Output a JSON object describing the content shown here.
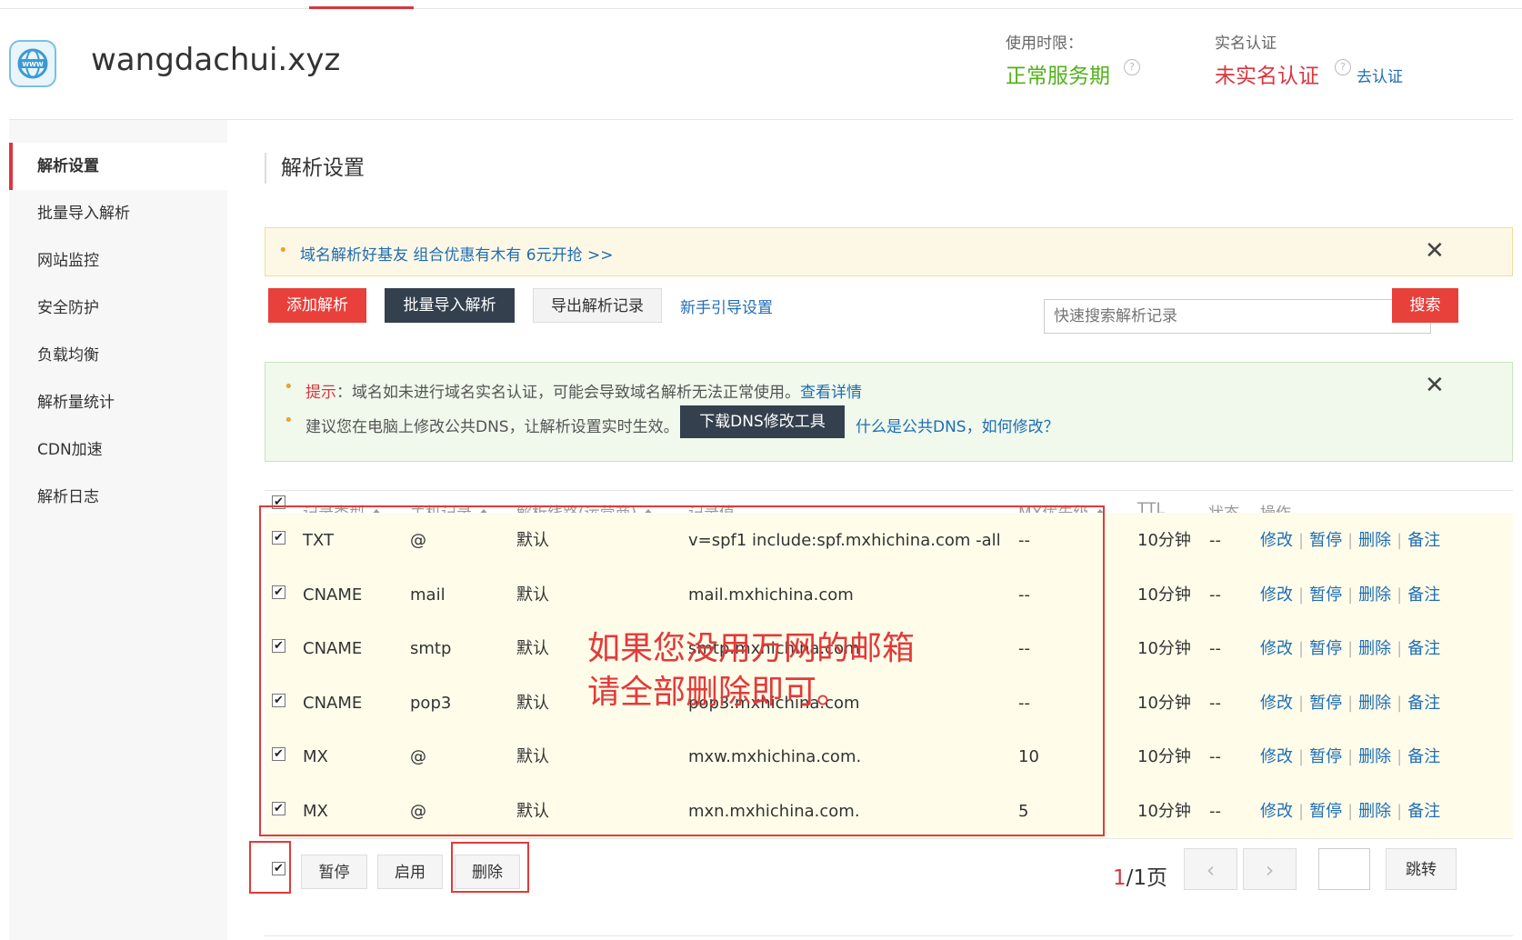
{
  "header": {
    "domain": "wangdachui.xyz",
    "usage_label": "使用时限：",
    "usage_value": "正常服务期",
    "realname_label": "实名认证",
    "realname_value": "未实名认证",
    "realname_link": "去认证",
    "help_glyph": "?",
    "colors": {
      "usage": "#52b21a",
      "realname": "#d9363e",
      "link": "#1f6db5"
    }
  },
  "sidebar": {
    "items": [
      {
        "label": "解析设置",
        "active": true
      },
      {
        "label": "批量导入解析"
      },
      {
        "label": "网站监控"
      },
      {
        "label": "安全防护"
      },
      {
        "label": "负载均衡"
      },
      {
        "label": "解析量统计"
      },
      {
        "label": "CDN加速"
      },
      {
        "label": "解析日志"
      }
    ]
  },
  "main": {
    "title": "解析设置",
    "promo": {
      "text": "域名解析好基友 组合优惠有木有 6元开抢 >>",
      "close": "✕"
    },
    "toolbar": {
      "add": "添加解析",
      "batch_import": "批量导入解析",
      "export": "导出解析记录",
      "guide": "新手引导设置",
      "search_placeholder": "快速搜索解析记录",
      "search": "搜索"
    },
    "notice": {
      "tip_label": "提示",
      "tip_text": "：域名如未进行域名实名认证，可能会导致域名解析无法正常使用。",
      "tip_link": "查看详情",
      "dns_text": "建议您在电脑上修改公共DNS，让解析设置实时生效。",
      "dns_button": "下载DNS修改工具",
      "dns_link": "什么是公共DNS，如何修改？",
      "close": "✕"
    }
  },
  "table": {
    "headers": [
      "记录类型",
      "主机记录",
      "解析线路(运营商)",
      "记录值",
      "MX优先级",
      "TTL",
      "状态",
      "操作"
    ],
    "rows": [
      {
        "type": "TXT",
        "host": "@",
        "line": "默认",
        "value": "v=spf1 include:spf.mxhichina.com -all",
        "mx": "--",
        "ttl": "10分钟",
        "status": "--"
      },
      {
        "type": "CNAME",
        "host": "mail",
        "line": "默认",
        "value": "mail.mxhichina.com",
        "mx": "--",
        "ttl": "10分钟",
        "status": "--"
      },
      {
        "type": "CNAME",
        "host": "smtp",
        "line": "默认",
        "value": "smtp.mxhichina.com",
        "mx": "--",
        "ttl": "10分钟",
        "status": "--"
      },
      {
        "type": "CNAME",
        "host": "pop3",
        "line": "默认",
        "value": "pop3.mxhichina.com",
        "mx": "--",
        "ttl": "10分钟",
        "status": "--"
      },
      {
        "type": "MX",
        "host": "@",
        "line": "默认",
        "value": "mxw.mxhichina.com.",
        "mx": "10",
        "ttl": "10分钟",
        "status": "--"
      },
      {
        "type": "MX",
        "host": "@",
        "line": "默认",
        "value": "mxn.mxhichina.com.",
        "mx": "5",
        "ttl": "10分钟",
        "status": "--"
      }
    ],
    "actions": [
      "修改",
      "暂停",
      "删除",
      "备注"
    ],
    "action_separator": "|",
    "checkbox_glyph": "✔"
  },
  "annotation": {
    "line1": "如果您没用万网的邮箱",
    "line2": "请全部删除即可。"
  },
  "footer": {
    "pause": "暂停",
    "enable": "启用",
    "delete": "删除",
    "page_current": "1",
    "page_total": "/1页",
    "prev": "‹",
    "next": "›",
    "jump": "跳转"
  }
}
